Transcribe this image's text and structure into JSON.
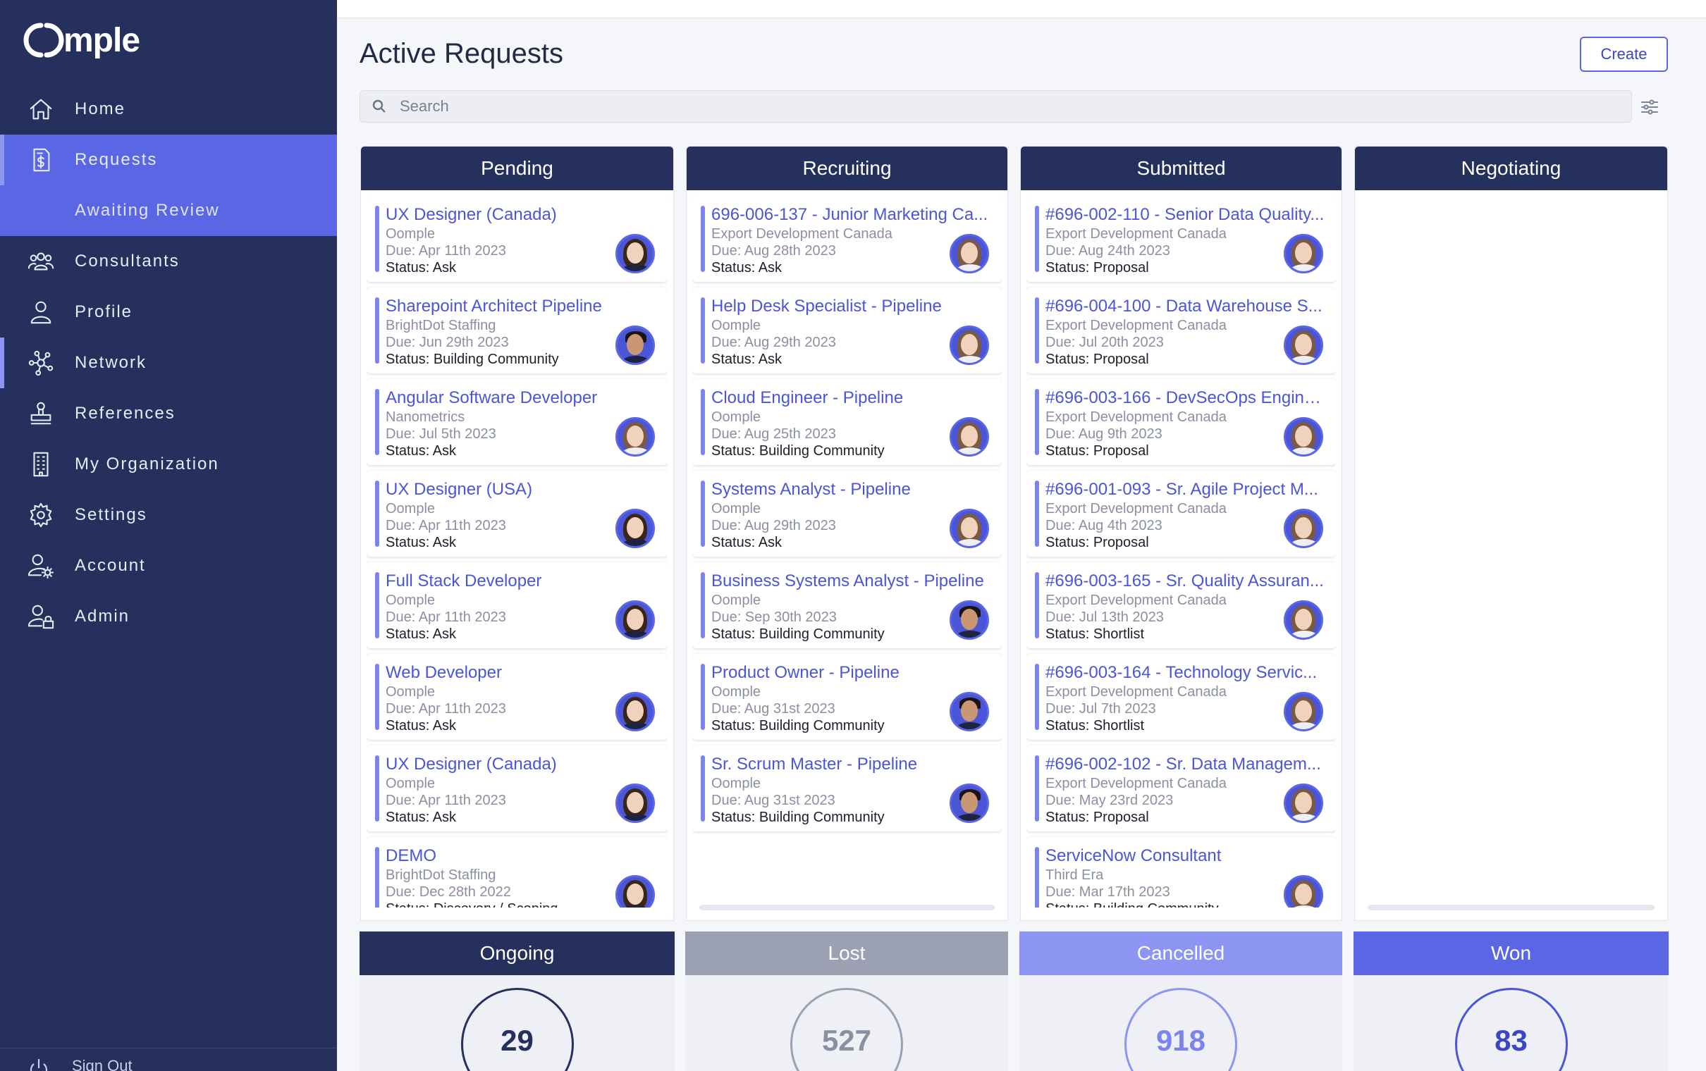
{
  "app": {
    "logo_text": "mple"
  },
  "sidebar": {
    "items": [
      {
        "label": "Home",
        "icon": "home-icon"
      },
      {
        "label": "Requests",
        "icon": "document-dollar-icon"
      },
      {
        "label": "Awaiting Review"
      },
      {
        "label": "Consultants",
        "icon": "users-icon"
      },
      {
        "label": "Profile",
        "icon": "user-icon"
      },
      {
        "label": "Network",
        "icon": "network-icon"
      },
      {
        "label": "References",
        "icon": "stamp-icon"
      },
      {
        "label": "My Organization",
        "icon": "building-icon"
      },
      {
        "label": "Settings",
        "icon": "gear-icon"
      },
      {
        "label": "Account",
        "icon": "user-gear-icon"
      },
      {
        "label": "Admin",
        "icon": "user-lock-icon"
      }
    ],
    "signout_label": "Sign Out"
  },
  "header": {
    "title": "Active Requests",
    "create_label": "Create"
  },
  "search": {
    "placeholder": "Search"
  },
  "board": {
    "columns": [
      {
        "title": "Pending",
        "cards": [
          {
            "title": "UX Designer (Canada)",
            "org": "Oomple",
            "due": "Due: Apr 11th 2023",
            "status": "Status: Ask",
            "avatar": "woman"
          },
          {
            "title": "Sharepoint Architect Pipeline",
            "org": "BrightDot Staffing",
            "due": "Due: Jun 29th 2023",
            "status": "Status: Building Community",
            "avatar": "man"
          },
          {
            "title": "Angular Software Developer",
            "org": "Nanometrics",
            "due": "Due: Jul 5th 2023",
            "status": "Status: Ask",
            "avatar": "light"
          },
          {
            "title": "UX Designer (USA)",
            "org": "Oomple",
            "due": "Due: Apr 11th 2023",
            "status": "Status: Ask",
            "avatar": "woman"
          },
          {
            "title": "Full Stack Developer",
            "org": "Oomple",
            "due": "Due: Apr 11th 2023",
            "status": "Status: Ask",
            "avatar": "woman"
          },
          {
            "title": "Web Developer",
            "org": "Oomple",
            "due": "Due: Apr 11th 2023",
            "status": "Status: Ask",
            "avatar": "woman"
          },
          {
            "title": "UX Designer (Canada)",
            "org": "Oomple",
            "due": "Due: Apr 11th 2023",
            "status": "Status: Ask",
            "avatar": "woman"
          },
          {
            "title": "DEMO",
            "org": "BrightDot Staffing",
            "due": "Due: Dec 28th 2022",
            "status": "Status: Discovery / Scoping",
            "avatar": "woman"
          }
        ]
      },
      {
        "title": "Recruiting",
        "cards": [
          {
            "title": "696-006-137 - Junior Marketing Ca...",
            "org": "Export Development Canada",
            "due": "Due: Aug 28th 2023",
            "status": "Status: Ask",
            "avatar": "light"
          },
          {
            "title": "Help Desk Specialist - Pipeline",
            "org": "Oomple",
            "due": "Due: Aug 29th 2023",
            "status": "Status: Ask",
            "avatar": "light"
          },
          {
            "title": "Cloud Engineer - Pipeline",
            "org": "Oomple",
            "due": "Due: Aug 25th 2023",
            "status": "Status: Building Community",
            "avatar": "light"
          },
          {
            "title": "Systems Analyst - Pipeline",
            "org": "Oomple",
            "due": "Due: Aug 29th 2023",
            "status": "Status: Ask",
            "avatar": "light"
          },
          {
            "title": "Business Systems Analyst - Pipeline",
            "org": "Oomple",
            "due": "Due: Sep 30th 2023",
            "status": "Status: Building Community",
            "avatar": "man"
          },
          {
            "title": "Product Owner - Pipeline",
            "org": "Oomple",
            "due": "Due: Aug 31st 2023",
            "status": "Status: Building Community",
            "avatar": "man"
          },
          {
            "title": "Sr. Scrum Master - Pipeline",
            "org": "Oomple",
            "due": "Due: Aug 31st 2023",
            "status": "Status: Building Community",
            "avatar": "man"
          }
        ]
      },
      {
        "title": "Submitted",
        "cards": [
          {
            "title": "#696-002-110 - Senior Data Quality...",
            "org": "Export Development Canada",
            "due": "Due: Aug 24th 2023",
            "status": "Status: Proposal",
            "avatar": "light"
          },
          {
            "title": "#696-004-100 - Data Warehouse S...",
            "org": "Export Development Canada",
            "due": "Due: Jul 20th 2023",
            "status": "Status: Proposal",
            "avatar": "light"
          },
          {
            "title": "#696-003-166 - DevSecOps Engine...",
            "org": "Export Development Canada",
            "due": "Due: Aug 9th 2023",
            "status": "Status: Proposal",
            "avatar": "light"
          },
          {
            "title": "#696-001-093 - Sr. Agile Project M...",
            "org": "Export Development Canada",
            "due": "Due: Aug 4th 2023",
            "status": "Status: Proposal",
            "avatar": "light"
          },
          {
            "title": "#696-003-165 - Sr. Quality Assuran...",
            "org": "Export Development Canada",
            "due": "Due: Jul 13th 2023",
            "status": "Status: Shortlist",
            "avatar": "light"
          },
          {
            "title": "#696-003-164 - Technology Servic...",
            "org": "Export Development Canada",
            "due": "Due: Jul 7th 2023",
            "status": "Status: Shortlist",
            "avatar": "light"
          },
          {
            "title": "#696-002-102 - Sr. Data Managem...",
            "org": "Export Development Canada",
            "due": "Due: May 23rd 2023",
            "status": "Status: Proposal",
            "avatar": "light"
          },
          {
            "title": "ServiceNow Consultant",
            "org": "Third Era",
            "due": "Due: Mar 17th 2023",
            "status": "Status: Building Community",
            "avatar": "light"
          }
        ]
      },
      {
        "title": "Negotiating",
        "cards": []
      }
    ]
  },
  "summary": [
    {
      "title": "Ongoing",
      "count": "29",
      "head_color": "#25305c",
      "ring_color": "#25305c",
      "text_color": "#25305c"
    },
    {
      "title": "Lost",
      "count": "527",
      "head_color": "#9ba1b3",
      "ring_color": "#9ba1b3",
      "text_color": "#8a90a2"
    },
    {
      "title": "Cancelled",
      "count": "918",
      "head_color": "#8c95f2",
      "ring_color": "#8c95f2",
      "text_color": "#7b84ee"
    },
    {
      "title": "Won",
      "count": "83",
      "head_color": "#5a66e3",
      "ring_color": "#4a55d8",
      "text_color": "#3b46c4"
    }
  ]
}
